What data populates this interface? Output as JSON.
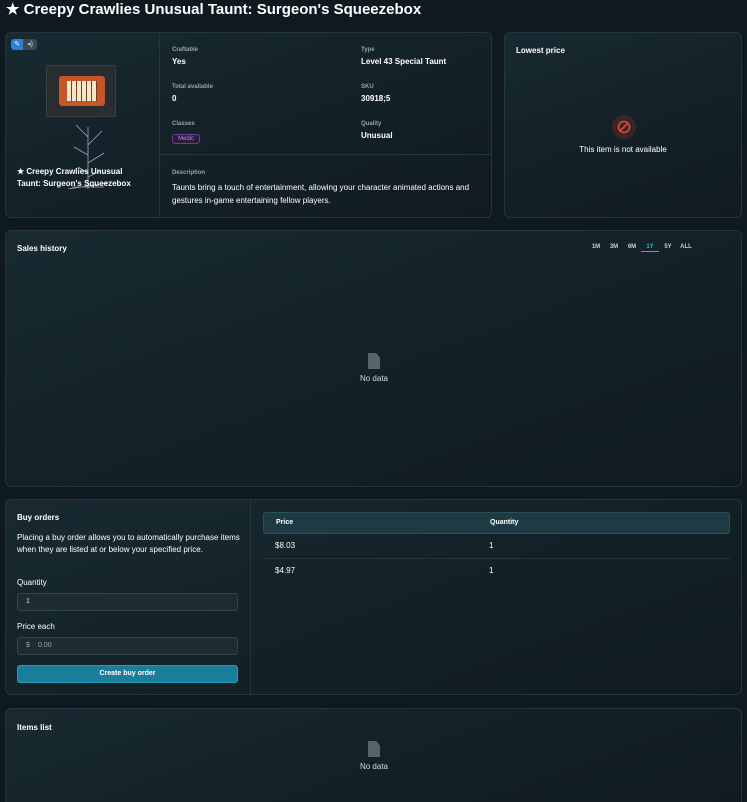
{
  "page": {
    "title": "★ Creepy Crawlies Unusual Taunt: Surgeon's Squeezebox"
  },
  "item": {
    "name": "★ Creepy Crawlies Unusual Taunt: Surgeon's Squeezebox",
    "badge_icons": [
      "paint-icon",
      "sound-icon"
    ],
    "fields": {
      "craftable_label": "Craftable",
      "craftable_value": "Yes",
      "type_label": "Type",
      "type_value": "Level 43 Special Taunt",
      "total_label": "Total available",
      "total_value": "0",
      "sku_label": "SKU",
      "sku_value": "30918;5",
      "classes_label": "Classes",
      "classes_value": "Medic",
      "quality_label": "Quality",
      "quality_value": "Unusual"
    },
    "description_label": "Description",
    "description": "Taunts bring a touch of entertainment, allowing your character animated actions and gestures in-game entertaining fellow players."
  },
  "lowest_price": {
    "title": "Lowest price",
    "message": "This item is not available",
    "icon": "no-entry-icon"
  },
  "sales_history": {
    "title": "Sales history",
    "ranges": [
      "1M",
      "3M",
      "6M",
      "1Y",
      "5Y",
      "ALL"
    ],
    "active_range": "1Y",
    "empty": "No data"
  },
  "buy_orders": {
    "title": "Buy orders",
    "description": "Placing a buy order allows you to automatically purchase items when they are listed at or below your specified price.",
    "quantity_label": "Quantity",
    "quantity_value": "1",
    "price_label": "Price each",
    "price_prefix": "$",
    "price_placeholder": "0.00",
    "button": "Create buy order",
    "table": {
      "headers": [
        "Price",
        "Quantity"
      ],
      "rows": [
        {
          "price": "$8.03",
          "quantity": "1"
        },
        {
          "price": "$4.97",
          "quantity": "1"
        }
      ]
    }
  },
  "items_list": {
    "title": "Items list",
    "empty": "No data"
  },
  "colors": {
    "accent": "#27b3d8",
    "button": "#1a7d9c",
    "medic": "#b684e8",
    "unavailable": "#e0483e"
  }
}
